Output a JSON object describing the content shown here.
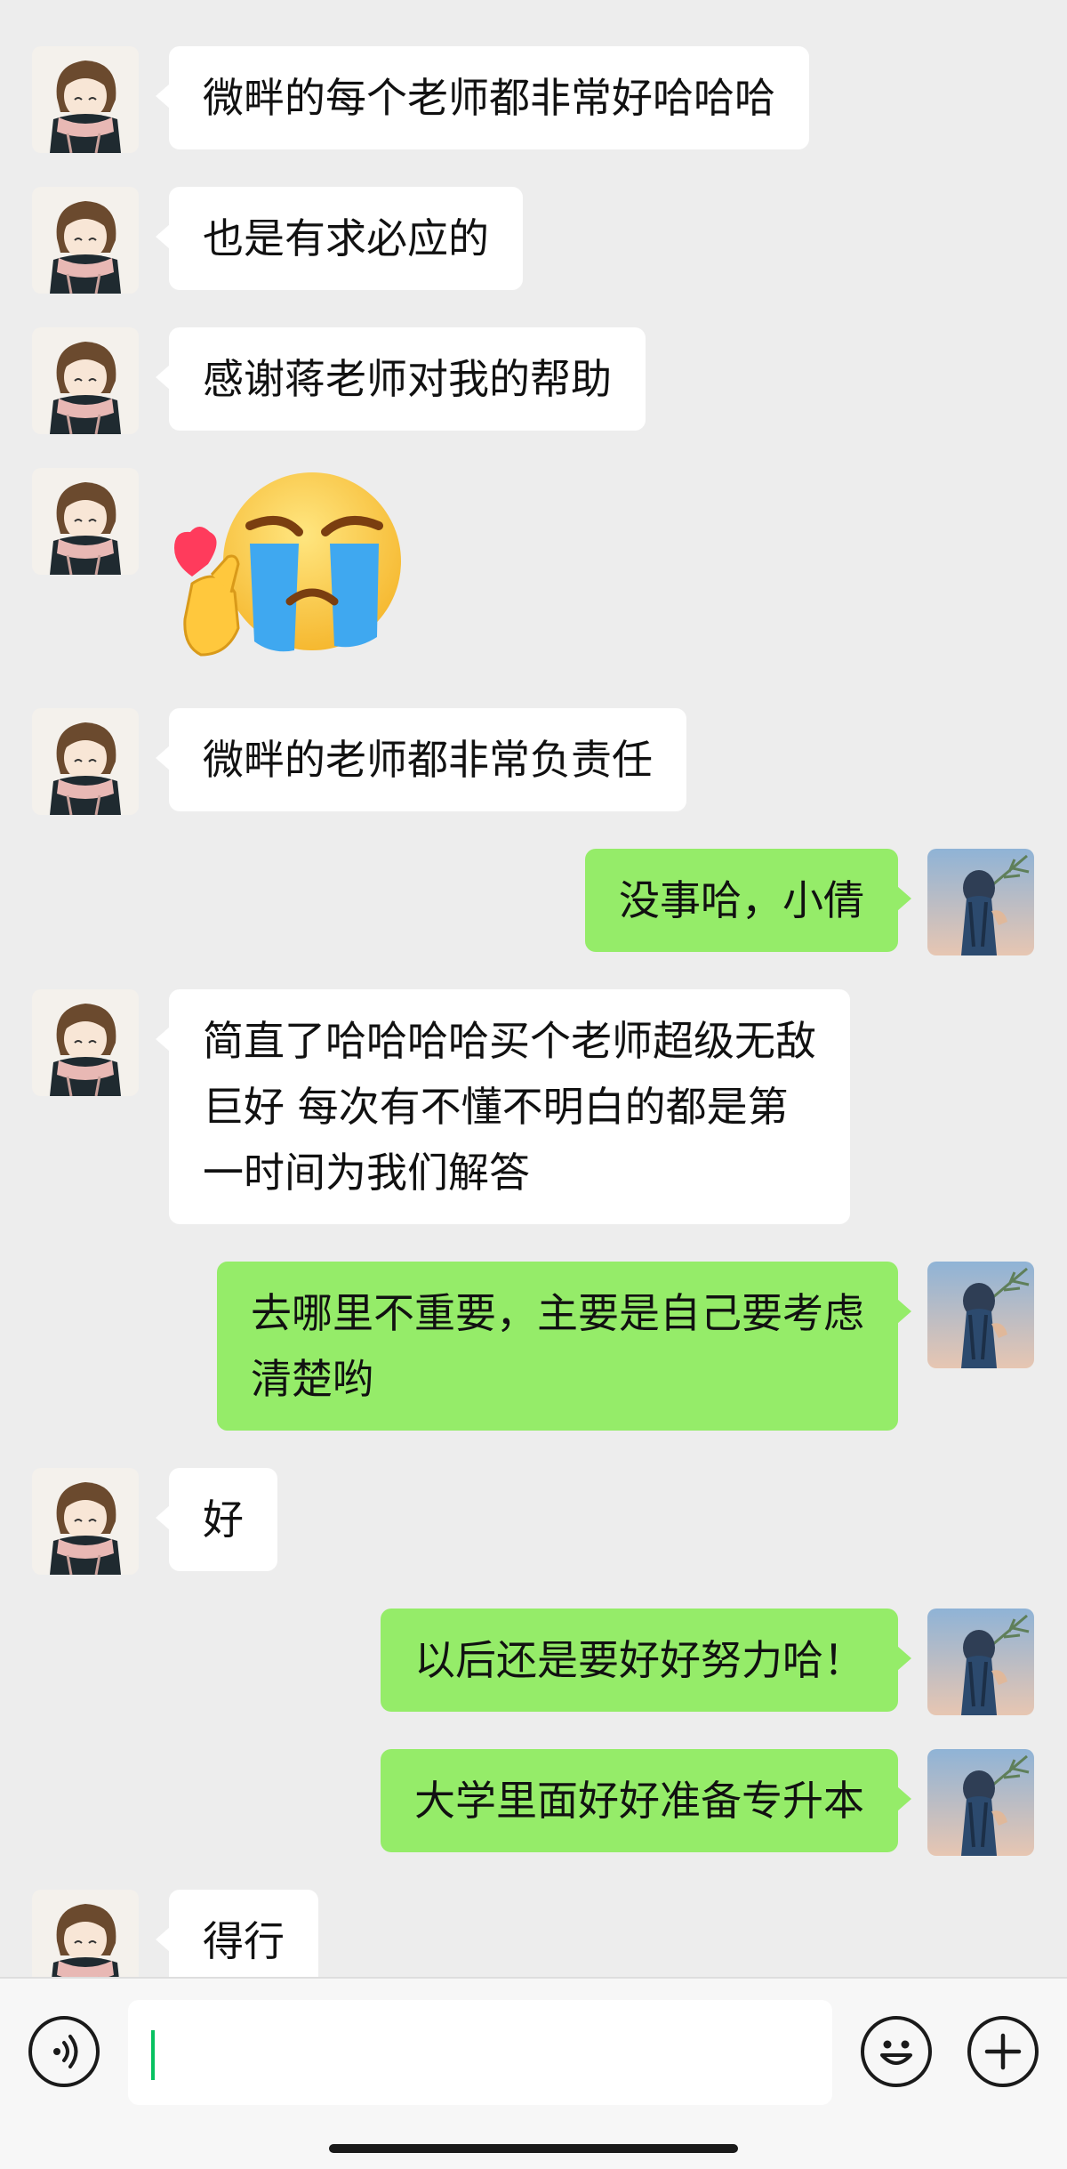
{
  "messages": [
    {
      "side": "left",
      "type": "text",
      "text": "微畔的每个老师都非常好哈哈哈"
    },
    {
      "side": "left",
      "type": "text",
      "text": "也是有求必应的"
    },
    {
      "side": "left",
      "type": "text",
      "text": "感谢蒋老师对我的帮助"
    },
    {
      "side": "left",
      "type": "sticker",
      "sticker": "crying-face-finger-heart"
    },
    {
      "side": "left",
      "type": "text",
      "text": "微畔的老师都非常负责任"
    },
    {
      "side": "right",
      "type": "text",
      "text": "没事哈，小倩"
    },
    {
      "side": "left",
      "type": "text",
      "text": "简直了哈哈哈哈买个老师超级无敌\n巨好 每次有不懂不明白的都是第\n一时间为我们解答"
    },
    {
      "side": "right",
      "type": "text",
      "text": "去哪里不重要，主要是自己要考虑\n清楚哟"
    },
    {
      "side": "left",
      "type": "text",
      "text": "好"
    },
    {
      "side": "right",
      "type": "text",
      "text": "以后还是要好好努力哈！"
    },
    {
      "side": "right",
      "type": "text",
      "text": "大学里面好好准备专升本"
    },
    {
      "side": "left",
      "type": "text",
      "text": "得行"
    }
  ],
  "toolbar": {
    "voice_icon": "voice-icon",
    "input_value": "",
    "emoji_icon": "emoji-icon",
    "more_icon": "plus-icon"
  },
  "colors": {
    "background": "#ededed",
    "incoming_bubble": "#ffffff",
    "outgoing_bubble": "#95ec69",
    "cursor": "#07c160"
  }
}
